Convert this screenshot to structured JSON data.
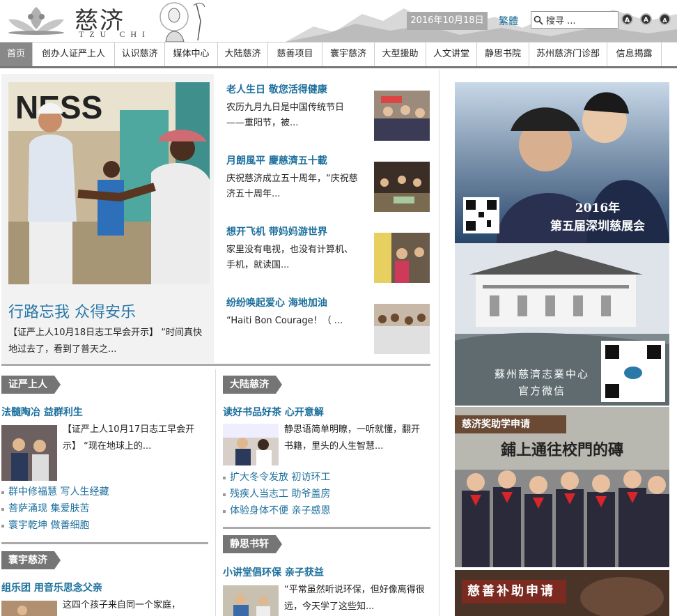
{
  "header": {
    "brand_cn": "慈济",
    "brand_en": "TZU CHI",
    "date": "2016年10月18日",
    "traditional_link": "繁體",
    "search_placeholder": "搜寻 ...",
    "font_buttons": [
      "A",
      "A",
      "A"
    ]
  },
  "nav": {
    "items": [
      "首页",
      "创办人证严上人",
      "认识慈济",
      "媒体中心",
      "大陆慈济",
      "慈善项目",
      "寰宇慈济",
      "大型援助",
      "人文讲堂",
      "静思书院",
      "苏州慈济门诊部",
      "信息揭露"
    ],
    "active_index": 0
  },
  "feature": {
    "title": "行路忘我  众得安乐",
    "desc": "【证严上人10月18日志工早会开示】 “时间真快地过去了，看到了普天之..."
  },
  "news": [
    {
      "title": "老人生日  敬您活得健康",
      "desc": "农历九月九日是中国传统节日——重阳节，被..."
    },
    {
      "title": "月朗風平  慶慈濟五十載",
      "desc": "庆祝慈济成立五十周年，“庆祝慈济五十周年..."
    },
    {
      "title": "想开飞机  带妈妈游世界",
      "desc": "家里没有电视，也没有计算机、手机，就读国..."
    },
    {
      "title": "纷纷唤起爱心  海地加油",
      "desc": "“Haiti Bon Courage！（ ..."
    }
  ],
  "section_zhengyan": {
    "heading": "证严上人",
    "title": "法髓陶冶  益群利生",
    "desc": "【证严上人10月17日志工早会开示】 “现在地球上的...",
    "links": [
      "群中修福慧  写人生经藏",
      "菩萨涌现  集爱肤苦",
      "寰宇乾坤  做善细胞"
    ]
  },
  "section_dalu": {
    "heading": "大陆慈济",
    "title": "读好书品好茶  心开意解",
    "desc": "静思语简单明瞭，一听就懂，翻开书籍，里头的人生智慧...",
    "links": [
      "扩大冬令发放  初访环工",
      "残疾人当志工  助爷盖房",
      "体验身体不便  亲子感恩"
    ]
  },
  "section_huanyu": {
    "heading": "寰宇慈济",
    "title": "组乐团  用音乐思念父亲",
    "desc": "这四个孩子来自同一个家庭，"
  },
  "section_jingsi": {
    "heading": "静思书轩",
    "title": "小讲堂倡环保  亲子获益",
    "desc": "“平常虽然听说环保，但好像离得很远，今天学了这些知..."
  },
  "banners": {
    "b1_caption": "2016年\n第五届深圳慈展会",
    "b2_caption": "蘇州慈濟志業中心\n官方微信",
    "b3_label": "慈济奖助学申请",
    "b3_caption": "鋪上通往校門的磚",
    "b4_caption": "慈善补助申请"
  }
}
